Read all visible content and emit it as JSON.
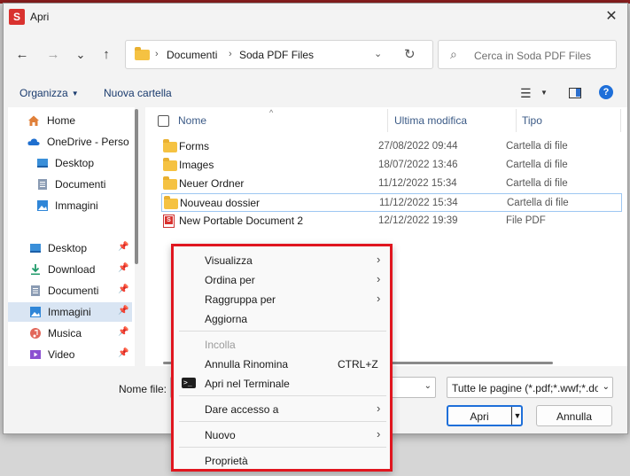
{
  "window": {
    "app_icon_letter": "S",
    "title": "Apri",
    "close": "✕"
  },
  "nav": {
    "back": "←",
    "forward": "→",
    "recent": "⌄",
    "up": "↑",
    "breadcrumb": [
      "Documenti",
      "Soda PDF Files"
    ],
    "separator": "›",
    "address_chevron": "⌄",
    "refresh": "↻",
    "search_icon": "⌕",
    "search_placeholder": "Cerca in Soda PDF Files"
  },
  "toolbar": {
    "organize": "Organizza",
    "new_folder": "Nuova cartella",
    "view_icon": "☰",
    "caret": "▼",
    "help": "?"
  },
  "sidebar": {
    "items": [
      {
        "label": "Home",
        "icon": "home-icon"
      },
      {
        "label": "OneDrive - Perso",
        "icon": "cloud-icon"
      },
      {
        "label": "Desktop",
        "icon": "desktop-icon"
      },
      {
        "label": "Documenti",
        "icon": "document-icon"
      },
      {
        "label": "Immagini",
        "icon": "image-icon"
      },
      {
        "label": "Desktop",
        "icon": "desktop-icon",
        "pinned": true
      },
      {
        "label": "Download",
        "icon": "download-icon",
        "pinned": true
      },
      {
        "label": "Documenti",
        "icon": "document-icon",
        "pinned": true
      },
      {
        "label": "Immagini",
        "icon": "image-icon",
        "pinned": true,
        "selected": true
      },
      {
        "label": "Musica",
        "icon": "music-icon",
        "pinned": true
      },
      {
        "label": "Video",
        "icon": "video-icon",
        "pinned": true
      }
    ],
    "pin_glyph": "📌"
  },
  "files": {
    "columns": {
      "name": "Nome",
      "modified": "Ultima modifica",
      "type": "Tipo"
    },
    "sort_indicator": "^",
    "rows": [
      {
        "name": "Forms",
        "modified": "27/08/2022 09:44",
        "type": "Cartella di file",
        "kind": "folder"
      },
      {
        "name": "Images",
        "modified": "18/07/2022 13:46",
        "type": "Cartella di file",
        "kind": "folder"
      },
      {
        "name": "Neuer Ordner",
        "modified": "11/12/2022 15:34",
        "type": "Cartella di file",
        "kind": "folder"
      },
      {
        "name": "Nouveau dossier",
        "modified": "11/12/2022 15:34",
        "type": "Cartella di file",
        "kind": "folder",
        "selected": true
      },
      {
        "name": "New Portable Document 2",
        "modified": "12/12/2022 19:39",
        "type": "File PDF",
        "kind": "pdf"
      }
    ]
  },
  "bottom": {
    "filename_label": "Nome file:",
    "filename_value": "",
    "filter": "Tutte le pagine (*.pdf;*.wwf;*.do",
    "open": "Apri",
    "cancel": "Annulla",
    "chevron": "⌄",
    "split_caret": "▼"
  },
  "context_menu": {
    "items": [
      {
        "label": "Visualizza",
        "submenu": true
      },
      {
        "label": "Ordina per",
        "submenu": true
      },
      {
        "label": "Raggruppa per",
        "submenu": true
      },
      {
        "label": "Aggiorna"
      },
      {
        "label": "Incolla",
        "disabled": true
      },
      {
        "label": "Annulla Rinomina",
        "shortcut": "CTRL+Z"
      },
      {
        "label": "Apri nel Terminale",
        "icon": "terminal-icon"
      },
      {
        "label": "Dare accesso a",
        "submenu": true
      },
      {
        "label": "Nuovo",
        "submenu": true
      },
      {
        "label": "Proprietà"
      }
    ],
    "submenu_arrow": "›"
  }
}
